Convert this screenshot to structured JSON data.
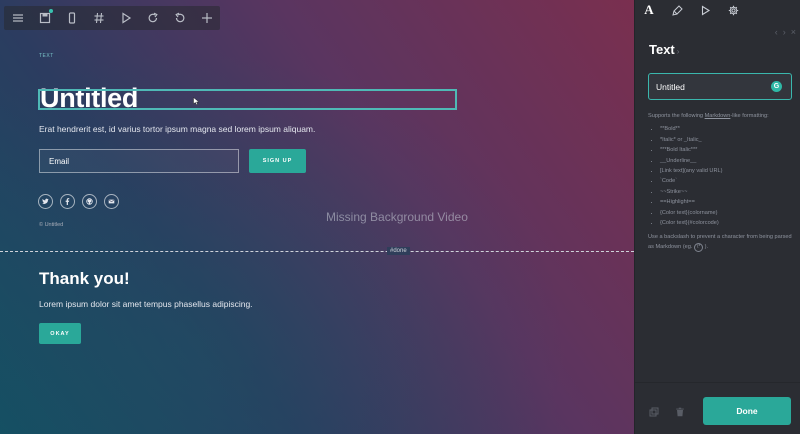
{
  "toolbar": {
    "items": [
      "menu-icon",
      "save-icon",
      "mobile-icon",
      "hash-icon",
      "play-icon",
      "redo-icon",
      "undo-icon",
      "plus-icon"
    ]
  },
  "section_a": {
    "tag": "TEXT",
    "title": "Untitled",
    "description": "Erat hendrerit est, id varius tortor ipsum magna sed lorem ipsum aliquam.",
    "email_placeholder": "Email",
    "signup_label": "SIGN UP",
    "socials": [
      "twitter-icon",
      "facebook-icon",
      "github-icon",
      "email-icon"
    ],
    "copyright": "© Untitled",
    "missing_video": "Missing Background Video"
  },
  "divider": {
    "label": "#done"
  },
  "section_b": {
    "title": "Thank you!",
    "description": "Lorem ipsum dolor sit amet tempus phasellus adipiscing.",
    "okay_label": "OKAY"
  },
  "panel": {
    "tabs": [
      "A",
      "brush-icon",
      "play-icon",
      "gear-icon"
    ],
    "nav": [
      "‹",
      "›",
      "×"
    ],
    "title": "Text",
    "title_chevron": "›",
    "field_value": "Untitled",
    "help_intro_before": "Supports the following ",
    "help_intro_link": "Markdown",
    "help_intro_after": "-like formatting:",
    "formats": [
      "**Bold**",
      "*Italic* or _Italic_",
      "***Bold Italic***",
      "__Underline__",
      "[Link text](any valid URL)",
      "`Code`",
      "~~Strike~~",
      "==Highlight==",
      "{Color text}(colorname)",
      "{Color text}(#colorcode)"
    ],
    "help_footer": "Use a backslash to prevent a character from being parsed as Markdown (eg.",
    "help_footer_key": "\\*",
    "help_footer_end": ").",
    "done_label": "Done",
    "colors": {
      "accent": "#2aa899",
      "panel_bg": "#2b2d33",
      "field_border": "#3ab7ad"
    }
  }
}
